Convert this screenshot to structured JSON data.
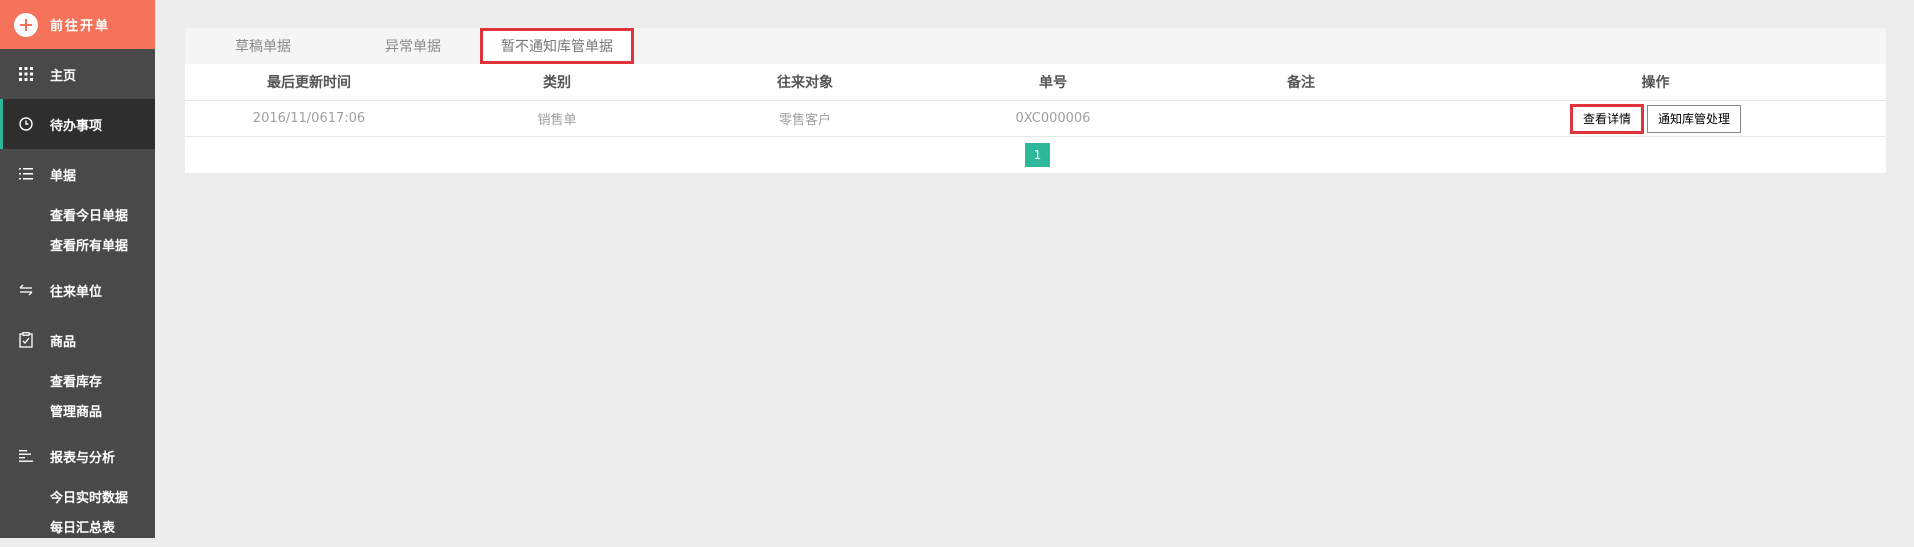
{
  "sidebar": {
    "new_order_label": "前往开单",
    "home_label": "主页",
    "todo_label": "待办事项",
    "orders": {
      "label": "单据",
      "items": [
        "查看今日单据",
        "查看所有单据"
      ]
    },
    "partners_label": "往来单位",
    "goods": {
      "label": "商品",
      "items": [
        "查看库存",
        "管理商品"
      ]
    },
    "reports": {
      "label": "报表与分析",
      "items": [
        "今日实时数据",
        "每日汇总表"
      ]
    }
  },
  "tabs": [
    "草稿单据",
    "异常单据",
    "暂不通知库管单据"
  ],
  "table": {
    "headers": [
      "最后更新时间",
      "类别",
      "往来对象",
      "单号",
      "备注",
      "操作"
    ],
    "rows": [
      {
        "time": "2016/11/0617:06",
        "type": "销售单",
        "party": "零售客户",
        "number": "0XC000006",
        "note": "",
        "view_button": "查看详情",
        "notify_button": "通知库管处理"
      }
    ]
  },
  "pagination": {
    "current_page": "1"
  },
  "colors": {
    "sidebar_bg": "#494949",
    "new_order_bg": "#f4735a",
    "accent_green": "#2db89a",
    "highlight_red": "#e0333a"
  }
}
